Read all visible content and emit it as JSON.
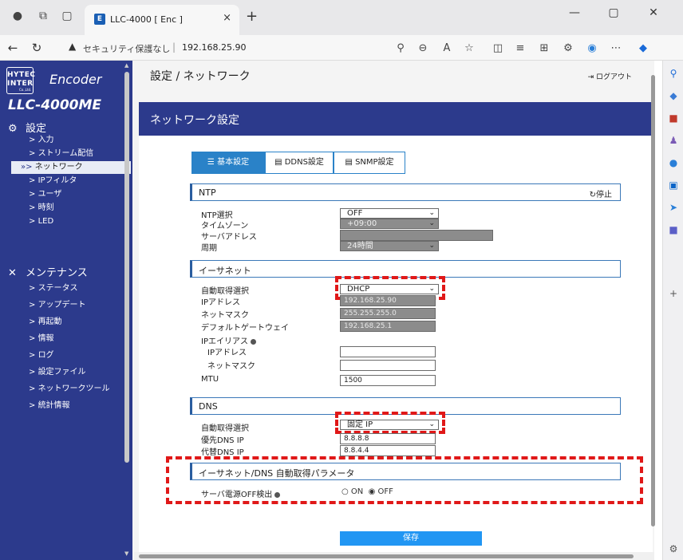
{
  "browser": {
    "tab_title": "LLC-4000 [ Enc ]",
    "tab_close": "×",
    "new_tab": "+",
    "security_text": "セキュリティ保護なし",
    "url": "192.168.25.90",
    "url_sep": "|",
    "win_min": "—",
    "win_max": "▢",
    "win_close": "✕"
  },
  "nav": {
    "logo_text": "HYTEC INTER",
    "logo_sub": "Co.,Ltd.",
    "encoder_label": "Encoder",
    "product": "LLC-4000ME",
    "settings_section": "設定",
    "settings_items": [
      "入力",
      "ストリーム配信",
      "ネットワーク",
      "IPフィルタ",
      "ユーザ",
      "時刻",
      "LED"
    ],
    "active_item": "ネットワーク",
    "maintenance_section": "メンテナンス",
    "maintenance_items": [
      "ステータス",
      "アップデート",
      "再起動",
      "情報",
      "ログ",
      "設定ファイル",
      "ネットワークツール",
      "統計情報"
    ]
  },
  "header": {
    "title": "設定 / ネットワーク",
    "logout": "ログアウト"
  },
  "panel": {
    "title": "ネットワーク設定",
    "tabs": [
      "基本設定",
      "DDNS設定",
      "SNMP設定"
    ],
    "active_tab": "基本設定"
  },
  "ntp": {
    "section": "NTP",
    "stop_label": "停止",
    "select_label": "NTP選択",
    "select_value": "OFF",
    "timezone_label": "タイムゾーン",
    "timezone_value": "+09:00",
    "server_label": "サーバアドレス",
    "server_value": "",
    "period_label": "周期",
    "period_value": "24時間"
  },
  "ethernet": {
    "section": "イーサネット",
    "auto_label": "自動取得選択",
    "auto_value": "DHCP",
    "ip_label": "IPアドレス",
    "ip_value": "192.168.25.90",
    "mask_label": "ネットマスク",
    "mask_value": "255.255.255.0",
    "gw_label": "デフォルトゲートウェイ",
    "gw_value": "192.168.25.1",
    "alias_label": "IPエイリアス",
    "alias_ip_label": "IPアドレス",
    "alias_ip_value": "",
    "alias_mask_label": "ネットマスク",
    "alias_mask_value": "",
    "mtu_label": "MTU",
    "mtu_value": "1500"
  },
  "dns": {
    "section": "DNS",
    "auto_label": "自動取得選択",
    "auto_value": "固定 IP",
    "primary_label": "優先DNS IP",
    "primary_value": "8.8.8.8",
    "secondary_label": "代替DNS IP",
    "secondary_value": "8.8.4.4"
  },
  "params": {
    "section": "イーサネット/DNS 自動取得パラメータ",
    "power_off_label": "サーバ電源OFF検出",
    "on_label": "ON",
    "off_label": "OFF",
    "selected": "OFF"
  },
  "save_label": "保存",
  "colors": {
    "nav_bg": "#2c3a8c",
    "tab_active": "#2a82c8",
    "save_button": "#2196f3",
    "highlight": "#e01818"
  }
}
